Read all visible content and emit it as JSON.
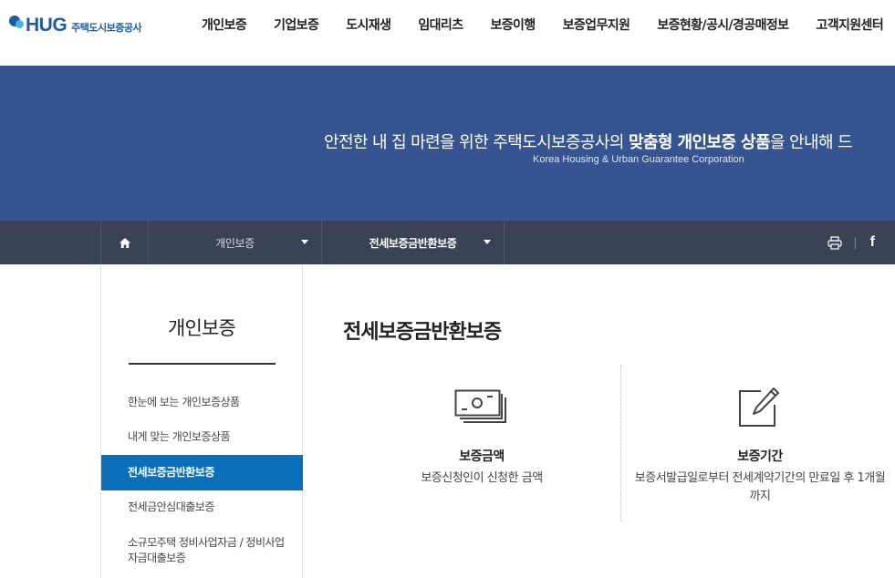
{
  "logo": {
    "brand": "HUG",
    "org_name": "주택도시보증공사"
  },
  "gnb": {
    "items": [
      {
        "label": "개인보증"
      },
      {
        "label": "기업보증"
      },
      {
        "label": "도시재생"
      },
      {
        "label": "임대리츠"
      },
      {
        "label": "보증이행"
      },
      {
        "label": "보증업무지원"
      },
      {
        "label": "보증현황/공시/경공매정보"
      },
      {
        "label": "고객지원센터"
      }
    ]
  },
  "banner": {
    "title_prefix": "안전한 내 집 마련을 위한 주택도시보증공사의 ",
    "title_bold": "맞춤형 개인보증 상품",
    "title_suffix": "을 안내해 드",
    "subtitle": "Korea Housing & Urban Guarantee Corporation"
  },
  "location": {
    "depth1": "개인보증",
    "depth2": "전세보증금반환보증",
    "icons": {
      "home": "home-icon",
      "print": "print-icon",
      "share": "facebook-icon"
    },
    "facebook": "f",
    "separator": "|"
  },
  "lnb": {
    "title": "개인보증",
    "items": [
      {
        "label": "한눈에 보는 개인보증상품",
        "active": false
      },
      {
        "label": "내게 맞는 개인보증상품",
        "active": false
      },
      {
        "label": "전세보증금반환보증",
        "active": true
      },
      {
        "label": "전세금안심대출보증",
        "active": false
      },
      {
        "label": "소규모주택 정비사업자금 / 정비사업자금대출보증",
        "active": false
      }
    ]
  },
  "content": {
    "page_title": "전세보증금반환보증",
    "cards": [
      {
        "icon": "money-icon",
        "title": "보증금액",
        "desc": "보증신청인이 신청한 금액"
      },
      {
        "icon": "edit-icon",
        "title": "보증기간",
        "desc": "보증서발급일로부터 전세계약기간의 만료일 후 1개월까지"
      }
    ]
  },
  "colors": {
    "banner_bg": "#36548f",
    "locbar_bg": "#3a4256",
    "active_bg": "#0b6fba",
    "brand": "#1e5aa8"
  }
}
